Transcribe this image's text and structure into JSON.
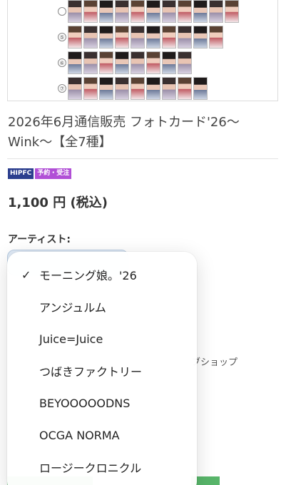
{
  "product": {
    "title": "2026年6月通信販売 フォトカード'26〜Wink〜【全7種】",
    "badges": [
      "HIPFC",
      "予約・受注"
    ],
    "price": "1,100 円 (税込)",
    "row_numbers": [
      "⑤",
      "⑥",
      "⑦"
    ]
  },
  "form": {
    "artist_label": "アーティスト:",
    "background_right_text": "ブショップ"
  },
  "dropdown": {
    "selected_index": 0,
    "options": [
      "モーニング娘。'26",
      "アンジュルム",
      "Juice=Juice",
      "つばきファクトリー",
      "BEYOOOOODNS",
      "OCGA NORMA",
      "ロージークロニクル"
    ],
    "check_glyph": "✓"
  },
  "colors": {
    "badge_hipfc": "#2c3f8e",
    "badge_reserve": "#b14fd6",
    "cart_button": "#58b56a"
  }
}
